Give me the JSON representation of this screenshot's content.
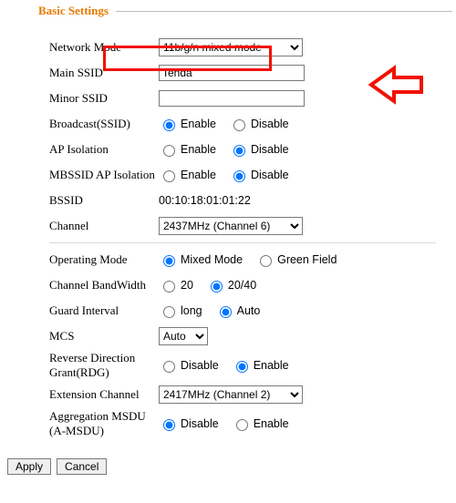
{
  "title": "Basic Settings",
  "labels": {
    "network_mode": "Network Mode",
    "main_ssid": "Main SSID",
    "minor_ssid": "Minor SSID",
    "broadcast_ssid": "Broadcast(SSID)",
    "ap_isolation": "AP Isolation",
    "mbssid_ap_isolation": "MBSSID AP Isolation",
    "bssid": "BSSID",
    "channel": "Channel",
    "operating_mode": "Operating Mode",
    "channel_bandwidth": "Channel BandWidth",
    "guard_interval": "Guard Interval",
    "mcs": "MCS",
    "rdg1": "Reverse Direction",
    "rdg2": "Grant(RDG)",
    "extension_channel": "Extension Channel",
    "amsdu1": "Aggregation MSDU",
    "amsdu2": "(A-MSDU)"
  },
  "values": {
    "network_mode": "11b/g/n mixed mode",
    "main_ssid": "Tenda",
    "minor_ssid": "",
    "bssid": "00:10:18:01:01:22",
    "channel": "2437MHz (Channel 6)",
    "mcs": "Auto",
    "extension_channel": "2417MHz (Channel 2)"
  },
  "options": {
    "enable": "Enable",
    "disable": "Disable",
    "mixed_mode": "Mixed Mode",
    "green_field": "Green Field",
    "bw20": "20",
    "bw2040": "20/40",
    "long": "long",
    "auto": "Auto"
  },
  "buttons": {
    "apply": "Apply",
    "cancel": "Cancel"
  }
}
